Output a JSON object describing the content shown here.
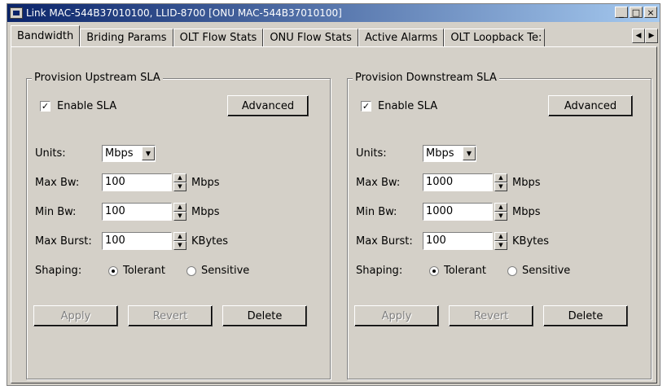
{
  "window": {
    "title": "Link MAC-544B37010100, LLID-8700 [ONU MAC-544B37010100]",
    "minimize": "_",
    "maximize": "□",
    "close": "×"
  },
  "tabs": [
    {
      "label": "Bandwidth",
      "active": true
    },
    {
      "label": "Briding Params"
    },
    {
      "label": "OLT Flow Stats"
    },
    {
      "label": "ONU Flow Stats"
    },
    {
      "label": "Active Alarms"
    },
    {
      "label": "OLT Loopback Te:"
    }
  ],
  "tab_scroll": {
    "left": "◀",
    "right": "▶"
  },
  "upstream": {
    "title": "Provision Upstream SLA",
    "enable_sla": {
      "label": "Enable SLA",
      "checked": true,
      "mark": "✓"
    },
    "advanced": "Advanced",
    "units_label": "Units:",
    "units_value": "Mbps",
    "max_bw_label": "Max Bw:",
    "max_bw_value": "100",
    "max_bw_unit": "Mbps",
    "min_bw_label": "Min Bw:",
    "min_bw_value": "100",
    "min_bw_unit": "Mbps",
    "max_burst_label": "Max Burst:",
    "max_burst_value": "100",
    "max_burst_unit": "KBytes",
    "shaping_label": "Shaping:",
    "shaping_tolerant": "Tolerant",
    "shaping_sensitive": "Sensitive",
    "apply": "Apply",
    "revert": "Revert",
    "delete": "Delete"
  },
  "downstream": {
    "title": "Provision Downstream SLA",
    "enable_sla": {
      "label": "Enable SLA",
      "checked": true,
      "mark": "✓"
    },
    "advanced": "Advanced",
    "units_label": "Units:",
    "units_value": "Mbps",
    "max_bw_label": "Max Bw:",
    "max_bw_value": "1000",
    "max_bw_unit": "Mbps",
    "min_bw_label": "Min Bw:",
    "min_bw_value": "1000",
    "min_bw_unit": "Mbps",
    "max_burst_label": "Max Burst:",
    "max_burst_value": "100",
    "max_burst_unit": "KBytes",
    "shaping_label": "Shaping:",
    "shaping_tolerant": "Tolerant",
    "shaping_sensitive": "Sensitive",
    "apply": "Apply",
    "revert": "Revert",
    "delete": "Delete"
  },
  "glyphs": {
    "dropdown": "▼",
    "spin_up": "▲",
    "spin_down": "▼"
  }
}
